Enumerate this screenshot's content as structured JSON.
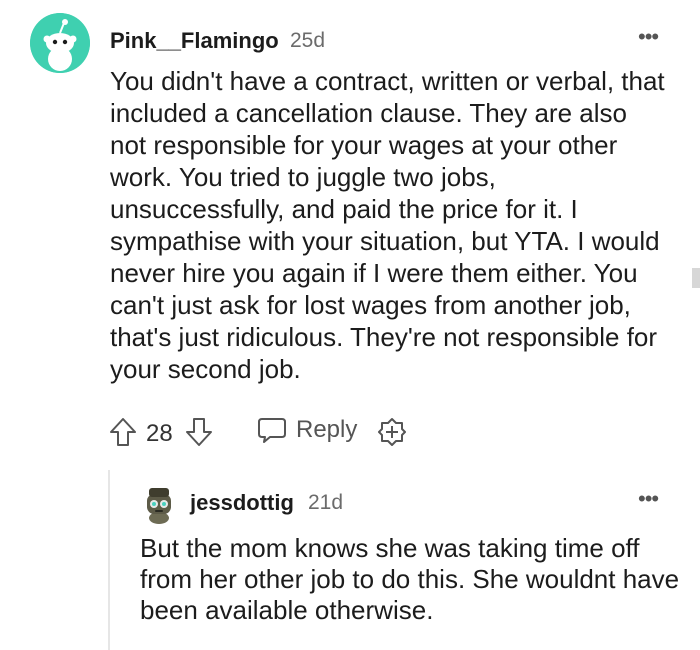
{
  "comment": {
    "username": "Pink__Flamingo",
    "time": "25d",
    "more": "•••",
    "body": "You didn't have a contract, written or verbal, that included a cancellation clause. They are also not responsible for your wages at your other work. You tried to juggle two jobs, unsuccessfully, and paid the price for it. I sympathise with your situation, but YTA. I would never hire you again if I were them either. You can't just ask for lost wages from another job, that's just ridiculous. They're not responsible for your second job.",
    "score": "28",
    "reply_label": "Reply",
    "avatar_color": "#3fd0b0"
  },
  "reply": {
    "username": "jessdottig",
    "time": "21d",
    "more": "•••",
    "body": "But the mom knows she was taking time off from her other job to do this. She wouldnt have been available otherwise."
  }
}
